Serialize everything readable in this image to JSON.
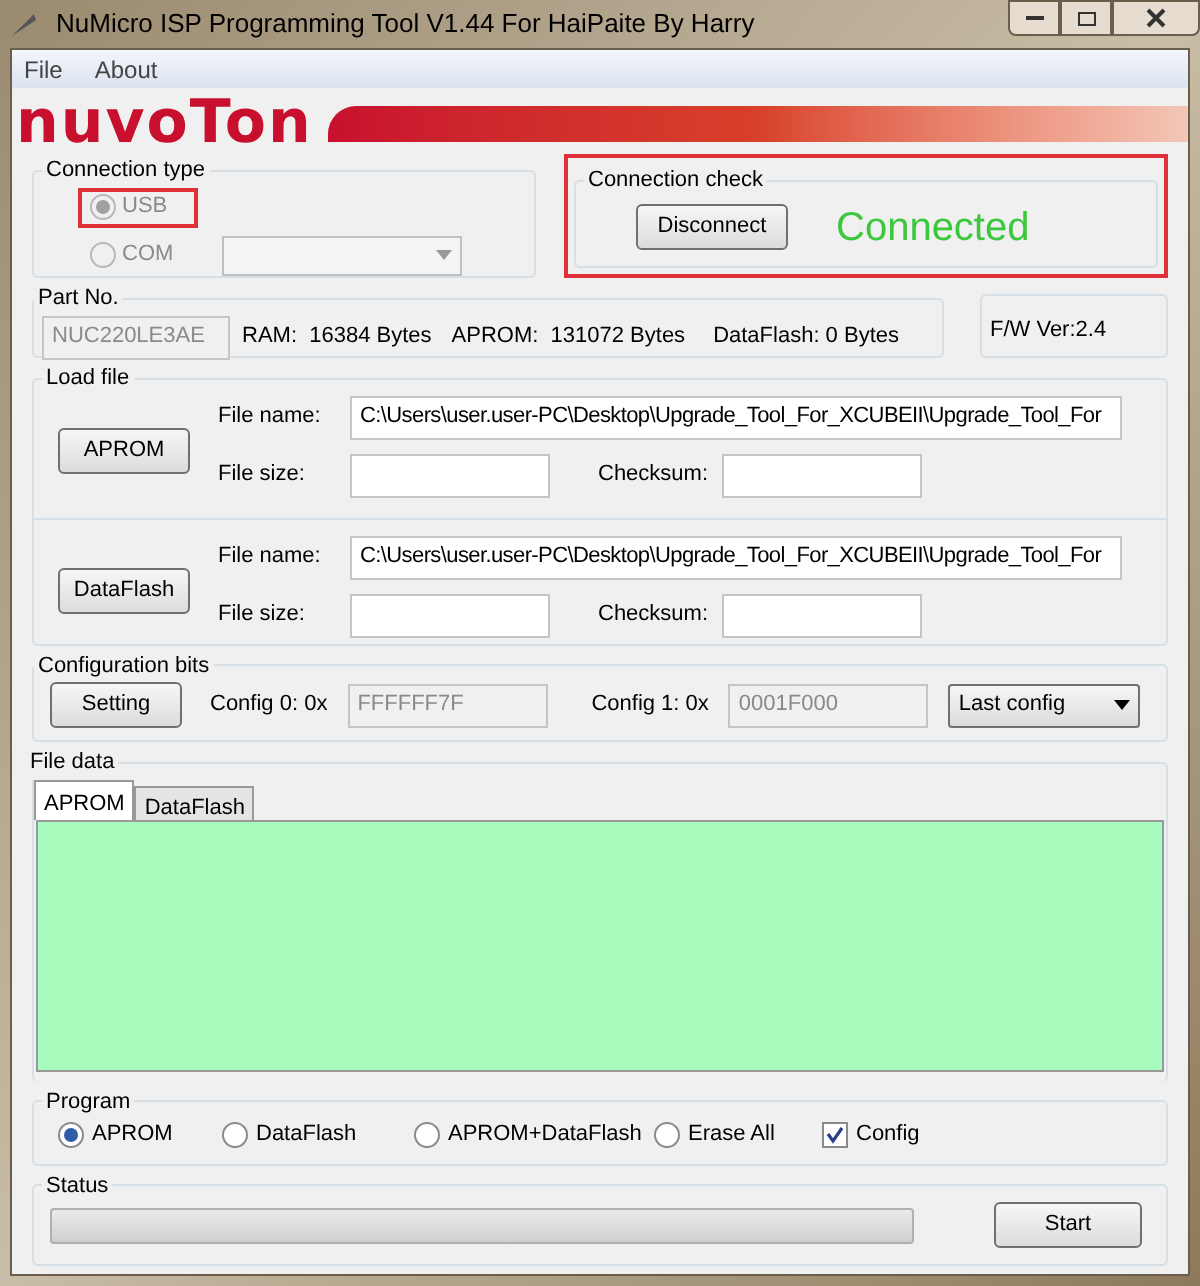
{
  "window": {
    "title": "NuMicro ISP Programming Tool V1.44 For HaiPaite By Harry"
  },
  "menu": [
    "File",
    "About"
  ],
  "logo": "nuvoTon",
  "connection_type": {
    "label": "Connection type",
    "options": [
      {
        "label": "USB",
        "selected": true,
        "disabled": true,
        "highlighted": true
      },
      {
        "label": "COM",
        "selected": false,
        "disabled": true,
        "highlighted": false
      }
    ]
  },
  "connection_check": {
    "label": "Connection check",
    "highlighted": true,
    "button": "Disconnect",
    "status": "Connected"
  },
  "part": {
    "label": "Part No.",
    "part_number": "NUC220LE3AE",
    "ram": "RAM:  16384 Bytes",
    "aprom": "APROM:  131072 Bytes",
    "dataflash": "DataFlash: 0 Bytes",
    "firmware": "F/W Ver:2.4"
  },
  "load_file": {
    "label": "Load file",
    "files": [
      {
        "button": "APROM",
        "file_name_label": "File name:",
        "file_name": "C:\\Users\\user.user-PC\\Desktop\\Upgrade_Tool_For_XCUBEII\\Upgrade_Tool_For",
        "file_size_label": "File size:",
        "checksum_label": "Checksum:"
      },
      {
        "button": "DataFlash",
        "file_name_label": "File name:",
        "file_name": "C:\\Users\\user.user-PC\\Desktop\\Upgrade_Tool_For_XCUBEII\\Upgrade_Tool_For",
        "file_size_label": "File size:",
        "checksum_label": "Checksum:"
      }
    ]
  },
  "config_bits": {
    "label": "Configuration bits",
    "button": "Setting",
    "config0_label": "Config 0: 0x",
    "config0": "FFFFFF7F",
    "config1_label": "Config 1: 0x",
    "config1": "0001F000",
    "mode": "Last config"
  },
  "file_data": {
    "label": "File data",
    "tabs": [
      {
        "label": "APROM",
        "selected": true
      },
      {
        "label": "DataFlash",
        "selected": false
      }
    ]
  },
  "program": {
    "label": "Program",
    "options": [
      {
        "kind": "radio",
        "label": "APROM",
        "selected": true
      },
      {
        "kind": "radio",
        "label": "DataFlash",
        "selected": false
      },
      {
        "kind": "radio",
        "label": "APROM+DataFlash",
        "selected": false
      },
      {
        "kind": "radio",
        "label": "Erase All",
        "selected": false
      },
      {
        "kind": "checkbox",
        "label": "Config",
        "checked": true
      }
    ]
  },
  "status": {
    "label": "Status",
    "level": 0,
    "button": "Start"
  }
}
